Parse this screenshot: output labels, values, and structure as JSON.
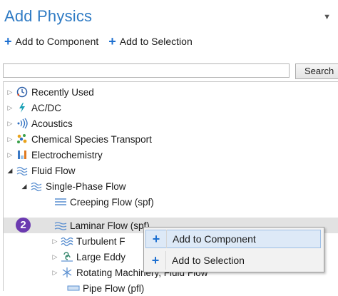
{
  "panel": {
    "title": "Add Physics",
    "title_controls": "▼"
  },
  "actions": {
    "add_to_component": "Add to Component",
    "add_to_selection": "Add to Selection"
  },
  "search": {
    "value": "",
    "placeholder": "",
    "button_label": "Search"
  },
  "tree": {
    "recently_used": "Recently Used",
    "acdc": "AC/DC",
    "acoustics": "Acoustics",
    "chemical_species_transport": "Chemical Species Transport",
    "electrochemistry": "Electrochemistry",
    "fluid_flow": "Fluid Flow",
    "single_phase_flow": "Single-Phase Flow",
    "creeping_flow": "Creeping Flow (spf)",
    "laminar_flow": "Laminar Flow (spf)",
    "turbulent_flow": "Turbulent F",
    "large_eddy": "Large Eddy",
    "rotating_machinery": "Rotating Machinery, Fluid Flow",
    "pipe_flow": "Pipe Flow (pfl)"
  },
  "callout": {
    "number": "2"
  },
  "context_menu": {
    "add_to_component": "Add to Component",
    "add_to_selection": "Add to Selection"
  },
  "colors": {
    "title": "#2f7bc4",
    "accent": "#1c6fd0",
    "badge": "#6b3ab0",
    "selection": "#e2e2e2"
  }
}
